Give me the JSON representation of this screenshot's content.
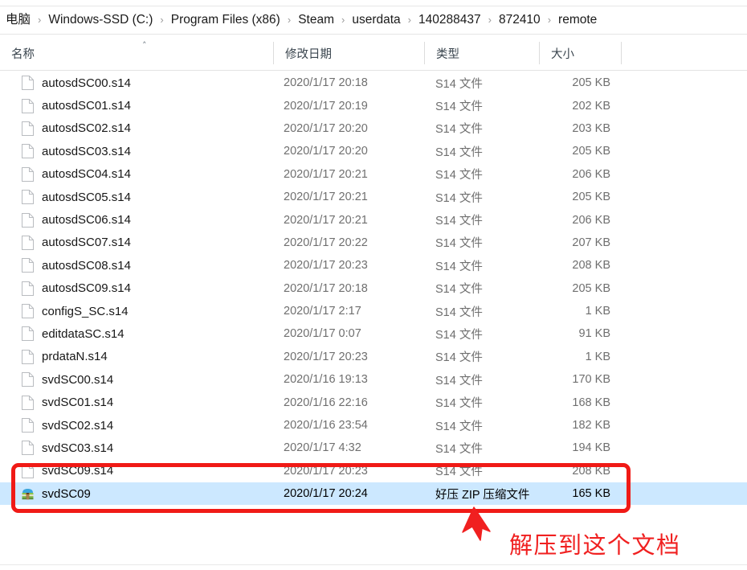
{
  "window": {
    "app": "Windows File Explorer"
  },
  "breadcrumb": {
    "separator": "›",
    "items": [
      "电脑",
      "Windows-SSD (C:)",
      "Program Files (x86)",
      "Steam",
      "userdata",
      "140288437",
      "872410",
      "remote"
    ]
  },
  "columns": {
    "headers": [
      {
        "label": "名称",
        "sorted": true,
        "sort_caret": "˄"
      },
      {
        "label": "修改日期",
        "sorted": false,
        "sort_caret": ""
      },
      {
        "label": "类型",
        "sorted": false,
        "sort_caret": ""
      },
      {
        "label": "大小",
        "sorted": false,
        "sort_caret": ""
      }
    ]
  },
  "files": [
    {
      "name": "autosdSC00.s14",
      "date": "2020/1/17 20:18",
      "type": "S14 文件",
      "size": "205 KB",
      "icon": "file-icon",
      "selected": false
    },
    {
      "name": "autosdSC01.s14",
      "date": "2020/1/17 20:19",
      "type": "S14 文件",
      "size": "202 KB",
      "icon": "file-icon",
      "selected": false
    },
    {
      "name": "autosdSC02.s14",
      "date": "2020/1/17 20:20",
      "type": "S14 文件",
      "size": "203 KB",
      "icon": "file-icon",
      "selected": false
    },
    {
      "name": "autosdSC03.s14",
      "date": "2020/1/17 20:20",
      "type": "S14 文件",
      "size": "205 KB",
      "icon": "file-icon",
      "selected": false
    },
    {
      "name": "autosdSC04.s14",
      "date": "2020/1/17 20:21",
      "type": "S14 文件",
      "size": "206 KB",
      "icon": "file-icon",
      "selected": false
    },
    {
      "name": "autosdSC05.s14",
      "date": "2020/1/17 20:21",
      "type": "S14 文件",
      "size": "205 KB",
      "icon": "file-icon",
      "selected": false
    },
    {
      "name": "autosdSC06.s14",
      "date": "2020/1/17 20:21",
      "type": "S14 文件",
      "size": "206 KB",
      "icon": "file-icon",
      "selected": false
    },
    {
      "name": "autosdSC07.s14",
      "date": "2020/1/17 20:22",
      "type": "S14 文件",
      "size": "207 KB",
      "icon": "file-icon",
      "selected": false
    },
    {
      "name": "autosdSC08.s14",
      "date": "2020/1/17 20:23",
      "type": "S14 文件",
      "size": "208 KB",
      "icon": "file-icon",
      "selected": false
    },
    {
      "name": "autosdSC09.s14",
      "date": "2020/1/17 20:18",
      "type": "S14 文件",
      "size": "205 KB",
      "icon": "file-icon",
      "selected": false
    },
    {
      "name": "configS_SC.s14",
      "date": "2020/1/17 2:17",
      "type": "S14 文件",
      "size": "1 KB",
      "icon": "file-icon",
      "selected": false
    },
    {
      "name": "editdataSC.s14",
      "date": "2020/1/17 0:07",
      "type": "S14 文件",
      "size": "91 KB",
      "icon": "file-icon",
      "selected": false
    },
    {
      "name": "prdataN.s14",
      "date": "2020/1/17 20:23",
      "type": "S14 文件",
      "size": "1 KB",
      "icon": "file-icon",
      "selected": false
    },
    {
      "name": "svdSC00.s14",
      "date": "2020/1/16 19:13",
      "type": "S14 文件",
      "size": "170 KB",
      "icon": "file-icon",
      "selected": false
    },
    {
      "name": "svdSC01.s14",
      "date": "2020/1/16 22:16",
      "type": "S14 文件",
      "size": "168 KB",
      "icon": "file-icon",
      "selected": false
    },
    {
      "name": "svdSC02.s14",
      "date": "2020/1/16 23:54",
      "type": "S14 文件",
      "size": "182 KB",
      "icon": "file-icon",
      "selected": false
    },
    {
      "name": "svdSC03.s14",
      "date": "2020/1/17 4:32",
      "type": "S14 文件",
      "size": "194 KB",
      "icon": "file-icon",
      "selected": false
    },
    {
      "name": "svdSC09.s14",
      "date": "2020/1/17 20:23",
      "type": "S14 文件",
      "size": "208 KB",
      "icon": "file-icon",
      "selected": false
    },
    {
      "name": "svdSC09",
      "date": "2020/1/17 20:24",
      "type": "好压 ZIP 压缩文件",
      "size": "165 KB",
      "icon": "zip-archive-icon",
      "selected": true
    }
  ],
  "annotation": {
    "text": "解压到这个文档",
    "color": "#f02020",
    "highlight_target": "svdSC09",
    "arrow": "up-arrow"
  },
  "colors": {
    "selection_bg": "#cce8ff",
    "annotation_red": "#f01a16",
    "header_text": "#3b464f",
    "secondary_text": "#6f6f6f"
  }
}
